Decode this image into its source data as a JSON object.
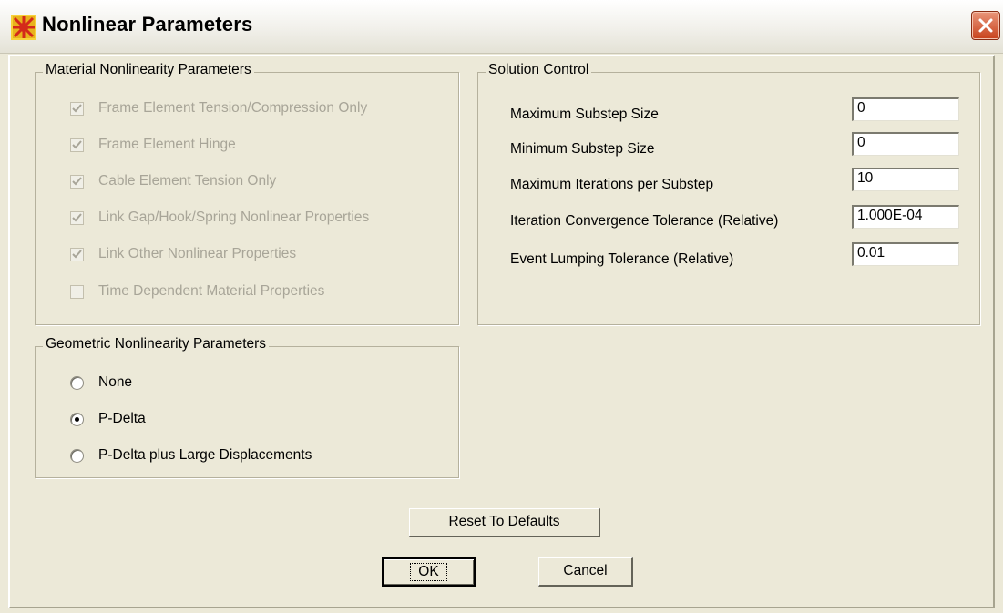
{
  "window": {
    "title": "Nonlinear Parameters",
    "icon": "app-logo-icon",
    "close_icon": "close-icon"
  },
  "material": {
    "legend": "Material Nonlinearity Parameters",
    "items": [
      {
        "label": "Frame Element Tension/Compression Only",
        "checked": true,
        "disabled": true
      },
      {
        "label": "Frame Element Hinge",
        "checked": true,
        "disabled": true
      },
      {
        "label": "Cable Element Tension Only",
        "checked": true,
        "disabled": true
      },
      {
        "label": "Link Gap/Hook/Spring Nonlinear Properties",
        "checked": true,
        "disabled": true
      },
      {
        "label": "Link Other Nonlinear Properties",
        "checked": true,
        "disabled": true
      },
      {
        "label": "Time Dependent Material Properties",
        "checked": false,
        "disabled": true
      }
    ]
  },
  "solution": {
    "legend": "Solution Control",
    "fields": [
      {
        "label": "Maximum Substep Size",
        "value": "0"
      },
      {
        "label": "Minimum Substep Size",
        "value": "0"
      },
      {
        "label": "Maximum Iterations per Substep",
        "value": "10"
      },
      {
        "label": "Iteration Convergence Tolerance (Relative)",
        "value": "1.000E-04"
      },
      {
        "label": "Event Lumping Tolerance (Relative)",
        "value": "0.01"
      }
    ]
  },
  "geometric": {
    "legend": "Geometric Nonlinearity Parameters",
    "options": [
      {
        "label": "None",
        "selected": false
      },
      {
        "label": "P-Delta",
        "selected": true
      },
      {
        "label": "P-Delta plus Large Displacements",
        "selected": false
      }
    ]
  },
  "buttons": {
    "reset": "Reset To Defaults",
    "ok": "OK",
    "cancel": "Cancel"
  },
  "colors": {
    "dialog_bg": "#ece9d8",
    "disabled_text": "#a8a598",
    "close_button": "#c8421c"
  }
}
